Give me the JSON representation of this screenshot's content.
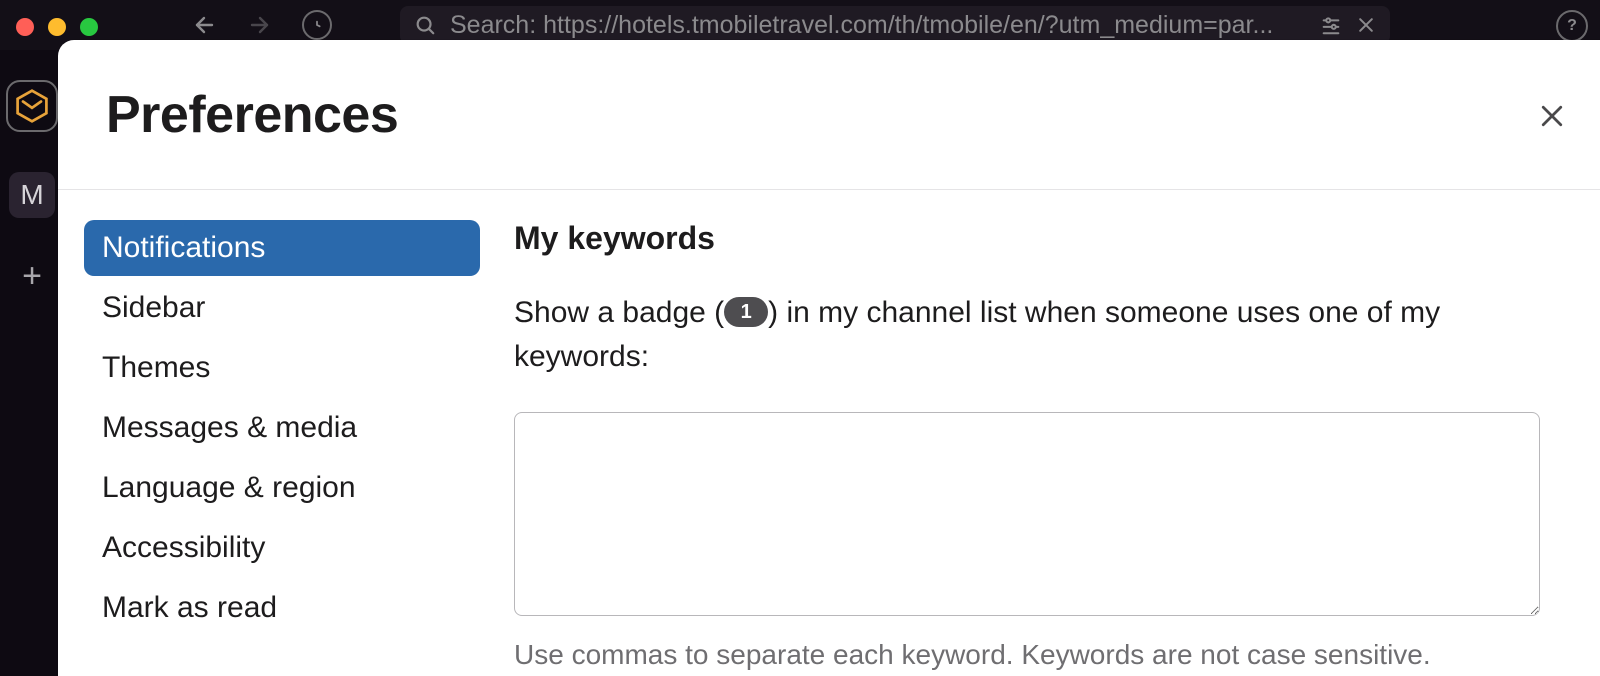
{
  "window": {
    "search_prefix": "Search:",
    "search_url": "https://hotels.tmobiletravel.com/th/tmobile/en/?utm_medium=par...",
    "letter_tile": "M"
  },
  "modal": {
    "title": "Preferences",
    "sidebar": {
      "items": [
        {
          "label": "Notifications",
          "active": true
        },
        {
          "label": "Sidebar",
          "active": false
        },
        {
          "label": "Themes",
          "active": false
        },
        {
          "label": "Messages & media",
          "active": false
        },
        {
          "label": "Language & region",
          "active": false
        },
        {
          "label": "Accessibility",
          "active": false
        },
        {
          "label": "Mark as read",
          "active": false
        }
      ]
    },
    "content": {
      "heading": "My keywords",
      "desc_before_badge": "Show a badge (",
      "badge_value": "1",
      "desc_after_badge": ") in my channel list when someone uses one of my keywords:",
      "keywords_value": "",
      "hint": "Use commas to separate each keyword. Keywords are not case sensitive."
    }
  }
}
